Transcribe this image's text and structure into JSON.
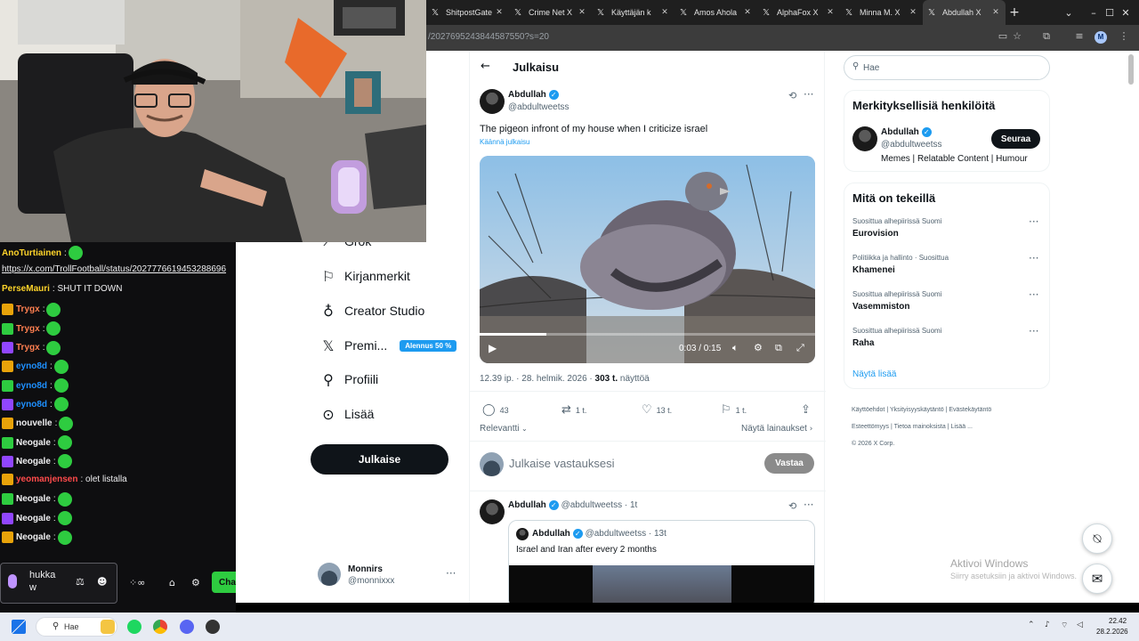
{
  "browser": {
    "tabs": [
      {
        "label": "ShitpostGate",
        "icon": "x-logo-icon",
        "active": false
      },
      {
        "label": "Crime Net X",
        "icon": "x-logo-icon",
        "active": false
      },
      {
        "label": "Käyttäjän k",
        "icon": "x-logo-icon",
        "active": false
      },
      {
        "label": "Amos Ahola",
        "icon": "x-logo-icon",
        "active": false
      },
      {
        "label": "AlphaFox X",
        "icon": "x-logo-icon",
        "active": false
      },
      {
        "label": "Minna M. X",
        "icon": "x-logo-icon",
        "active": false
      },
      {
        "label": "Abdullah X",
        "icon": "x-logo-icon",
        "active": true
      }
    ],
    "url": "/2027695243844587550?s=20",
    "profile_initial": "M"
  },
  "nav": {
    "grok": "Grok",
    "bookmarks": "Kirjanmerkit",
    "creator_studio": "Creator Studio",
    "premium": "Premi...",
    "premium_badge": "Alennus 50 %",
    "profile": "Profiili",
    "more": "Lisää",
    "post_button": "Julkaise",
    "account_name": "Monnirs",
    "account_handle": "@monnixxx"
  },
  "post": {
    "header": "Julkaisu",
    "author_name": "Abdullah",
    "author_handle": "@abdultweetss",
    "text": "The pigeon infront of my house when I criticize israel",
    "translate": "Käännä julkaisu",
    "video_time": "0:03 / 0:15",
    "video_progress": 0.2,
    "meta_time": "12.39 ip. · 28. helmik. 2026 · ",
    "views_count": "303 t.",
    "views_label": " näyttöä",
    "replies": "43",
    "reposts": "1 t.",
    "likes": "13 t.",
    "bookmarks": "1 t.",
    "sort_label": "Relevantti",
    "quotes_link": "Näytä lainaukset",
    "reply_placeholder": "Julkaise vastauksesi",
    "reply_button": "Vastaa"
  },
  "reply": {
    "author_name": "Abdullah",
    "author_handle": "@abdultweetss",
    "time": "· 1t",
    "quote_author": "Abdullah",
    "quote_handle": "@abdultweetss",
    "quote_time": "· 13t",
    "quote_text": "Israel and Iran after every 2 months"
  },
  "sidebar": {
    "search_placeholder": "Hae",
    "relevant_title": "Merkityksellisiä henkilöitä",
    "person_name": "Abdullah",
    "person_handle": "@abdultweetss",
    "person_bio": "Memes | Relatable Content | Humour",
    "follow_button": "Seuraa",
    "trends_title": "Mitä on tekeillä",
    "trends": [
      {
        "context": "Suosittua alhepiirissä Suomi",
        "name": "Eurovision"
      },
      {
        "context": "Politiikka ja hallinto · Suosittua",
        "name": "Khamenei"
      },
      {
        "context": "Suosittua alhepiirissä Suomi",
        "name": "Vasemmiston"
      },
      {
        "context": "Suosittua alhepiirissä Suomi",
        "name": "Raha"
      }
    ],
    "show_more": "Näytä lisää",
    "footer": [
      "Käyttöehdot",
      "Yksityisyyskäytäntö",
      "Evästekäytäntö",
      "Esteettömyys",
      "Tietoa mainoksista",
      "Lisää ...",
      "© 2026 X Corp."
    ],
    "activate_title": "Aktivoi Windows",
    "activate_sub": "Siirry asetuksiin ja aktivoi Windows."
  },
  "chat": {
    "messages": [
      {
        "user": "AnoTurtiainen",
        "color": "#ffd42a",
        "text": ":"
      },
      {
        "user": "",
        "color": "#efeff1",
        "text": "https://x.com/TrollFootball/status/2027776619453288696"
      },
      {
        "user": "PerseMauri",
        "color": "#ffd42a",
        "text": ": SHUT IT DOWN"
      },
      {
        "user": "Trygx",
        "color": "#ff7f50",
        "text": ":"
      },
      {
        "user": "Trygx",
        "color": "#ff7f50",
        "text": ":"
      },
      {
        "user": "Trygx",
        "color": "#ff7f50",
        "text": ":"
      },
      {
        "user": "eyno8d",
        "color": "#1e90ff",
        "text": ":"
      },
      {
        "user": "eyno8d",
        "color": "#1e90ff",
        "text": ":"
      },
      {
        "user": "eyno8d",
        "color": "#1e90ff",
        "text": ":"
      },
      {
        "user": "nouvelle",
        "color": "#efeff1",
        "text": ":"
      },
      {
        "user": "Neogale",
        "color": "#efeff1",
        "text": ":"
      },
      {
        "user": "Neogale",
        "color": "#efeff1",
        "text": ":"
      },
      {
        "user": "yeomanjensen",
        "color": "#ff4b4b",
        "text": ": olet listalla"
      },
      {
        "user": "Neogale",
        "color": "#efeff1",
        "text": ":"
      },
      {
        "user": "Neogale",
        "color": "#efeff1",
        "text": ":"
      },
      {
        "user": "Neogale",
        "color": "#efeff1",
        "text": ":"
      }
    ],
    "input_text": "hukka w",
    "chat_button": "Cha"
  },
  "taskbar": {
    "search": "Hae",
    "time": "22.42",
    "date": "28.2.2026"
  }
}
